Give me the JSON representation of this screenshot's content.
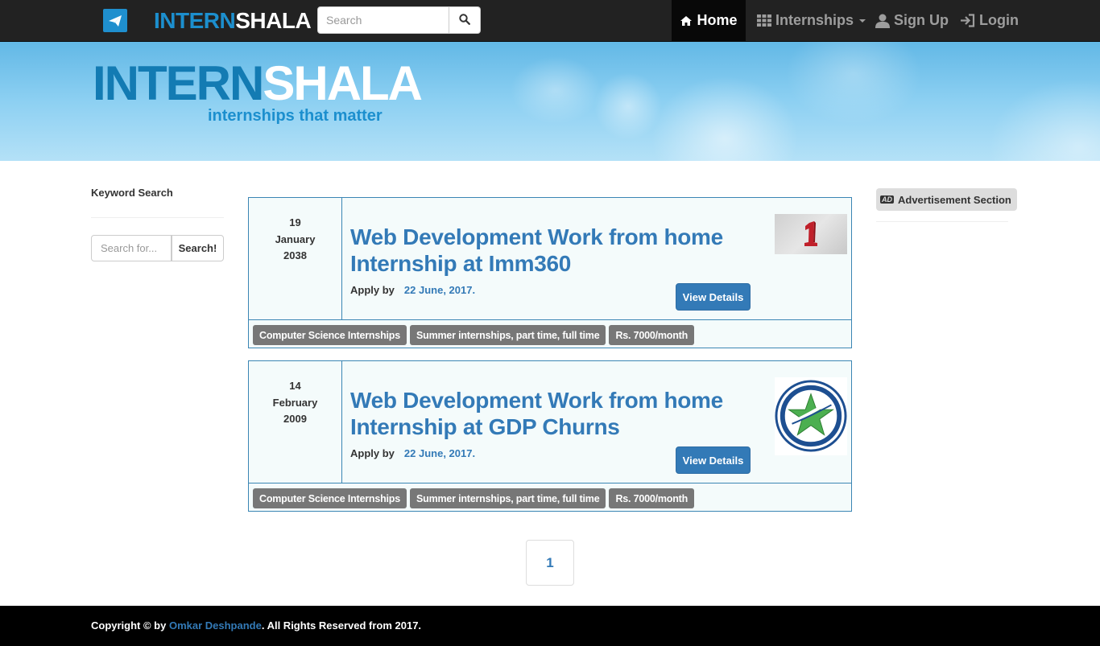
{
  "navbar": {
    "brand_intern": "INTERN",
    "brand_shala": "SHALA",
    "search_placeholder": "Search",
    "items": [
      {
        "label": "Home",
        "icon": "home-icon",
        "active": true
      },
      {
        "label": "Internships",
        "icon": "grid-icon",
        "dropdown": true
      },
      {
        "label": "Sign Up",
        "icon": "user-icon"
      },
      {
        "label": "Login",
        "icon": "login-icon"
      }
    ]
  },
  "banner": {
    "logo_intern": "INTERN",
    "logo_shala": "SHALA",
    "tagline": "internships that matter"
  },
  "sidebar": {
    "title": "Keyword Search",
    "search_placeholder": "Search for...",
    "search_button": "Search!"
  },
  "listings": [
    {
      "day": "19",
      "month": "January",
      "year": "2038",
      "title": "Web Development Work from home Internship at Imm360",
      "apply_label": "Apply by",
      "deadline": "22 June, 2017.",
      "button": "View Details",
      "logo": "red-1-logo",
      "tags": [
        "Computer Science Internships",
        "Summer internships, part time, full time",
        "Rs. 7000/month"
      ]
    },
    {
      "day": "14",
      "month": "February",
      "year": "2009",
      "title": "Web Development Work from home Internship at GDP Churns",
      "apply_label": "Apply by",
      "deadline": "22 June, 2017.",
      "button": "View Details",
      "logo": "star-seal-logo",
      "tags": [
        "Computer Science Internships",
        "Summer internships, part time, full time",
        "Rs. 7000/month"
      ]
    }
  ],
  "ad": {
    "label": "Advertisement Section",
    "icon_text": "AD"
  },
  "pagination": {
    "current": "1"
  },
  "footer": {
    "prefix": "Copyright © by ",
    "author": "Omkar Deshpande",
    "suffix": ". All Rights Reserved from 2017."
  },
  "colors": {
    "navbar_bg": "#222222",
    "brand_blue": "#1c8fce",
    "link_blue": "#337ab7",
    "card_border": "#3b86b4",
    "tag_bg": "#777777"
  }
}
